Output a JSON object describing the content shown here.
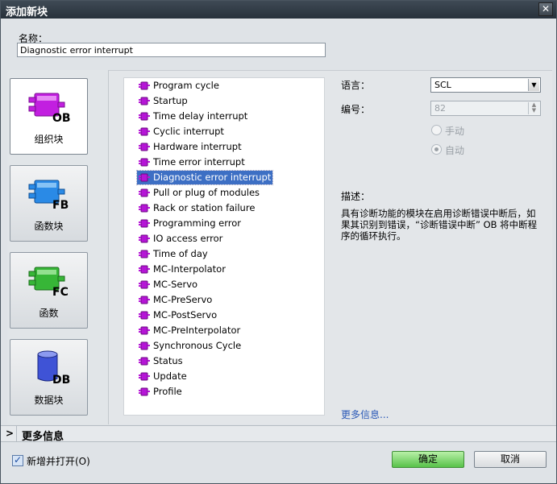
{
  "dialog": {
    "title": "添加新块",
    "close_label": "✕"
  },
  "name_field": {
    "label": "名称：",
    "value": "Diagnostic error interrupt"
  },
  "block_types": [
    {
      "label": "组织块",
      "badge": "OB",
      "color": "#b515d6"
    },
    {
      "label": "函数块",
      "badge": "FB",
      "color": "#1f7fd8"
    },
    {
      "label": "函数",
      "badge": "FC",
      "color": "#2fae2f"
    },
    {
      "label": "数据块",
      "badge": "DB",
      "color": "#3f53d6"
    }
  ],
  "ob_list": [
    "Program cycle",
    "Startup",
    "Time delay interrupt",
    "Cyclic interrupt",
    "Hardware interrupt",
    "Time error interrupt",
    "Diagnostic error interrupt",
    "Pull or plug of modules",
    "Rack or station failure",
    "Programming error",
    "IO access error",
    "Time of day",
    "MC-Interpolator",
    "MC-Servo",
    "MC-PreServo",
    "MC-PostServo",
    "MC-PreInterpolator",
    "Synchronous Cycle",
    "Status",
    "Update",
    "Profile"
  ],
  "selected_item": "Diagnostic error interrupt",
  "properties": {
    "language_label": "语言：",
    "language_value": "SCL",
    "number_label": "编号：",
    "number_value": "82",
    "manual_label": "手动",
    "auto_label": "自动",
    "description_label": "描述：",
    "description_text": "具有诊断功能的模块在启用诊断错误中断后，如果其识别到错误，“诊断错误中断” OB 将中断程序的循环执行。",
    "more_info_link": "更多信息..."
  },
  "more_info_bar": {
    "label": "更多信息"
  },
  "footer": {
    "add_open_label": "新增并打开(O)",
    "ok_label": "确定",
    "cancel_label": "取消"
  },
  "colors": {
    "selected_row": "#3d6fc4",
    "ok_button": "#58c24a",
    "titlebar": "#2e3842"
  }
}
